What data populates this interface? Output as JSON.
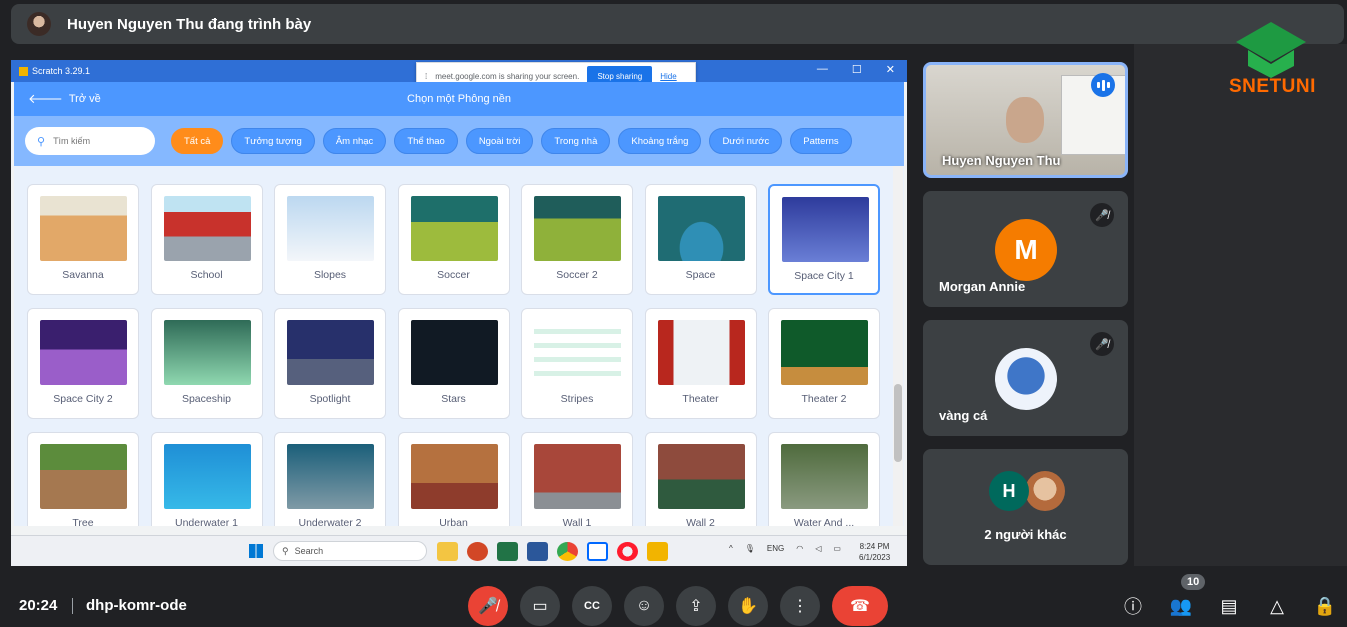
{
  "top_bar": {
    "presenter_text": "Huyen Nguyen Thu đang trình bày"
  },
  "window": {
    "title": "Scratch 3.29.1",
    "controls": [
      "—",
      "☐",
      "✕"
    ],
    "share_banner": {
      "text": "meet.google.com is sharing your screen.",
      "stop": "Stop sharing",
      "hide": "Hide"
    }
  },
  "scratch": {
    "back_label": "Trở về",
    "header_title": "Chọn một Phông nền",
    "search_placeholder": "Tìm kiếm",
    "categories": [
      "Tất cả",
      "Tưởng tượng",
      "Âm nhạc",
      "Thể thao",
      "Ngoài trời",
      "Trong nhà",
      "Khoảng trắng",
      "Dưới nước",
      "Patterns"
    ],
    "active_category": "Tất cả",
    "backdrops": [
      "Savanna",
      "School",
      "Slopes",
      "Soccer",
      "Soccer 2",
      "Space",
      "Space City 1",
      "Space City 2",
      "Spaceship",
      "Spotlight",
      "Stars",
      "Stripes",
      "Theater",
      "Theater 2",
      "Tree",
      "Underwater 1",
      "Underwater 2",
      "Urban",
      "Wall 1",
      "Wall 2",
      "Water And ..."
    ],
    "selected_backdrop": "Space City 1"
  },
  "taskbar": {
    "search": "Search",
    "lang": "ENG",
    "time": "8:24 PM",
    "date": "6/1/2023"
  },
  "logo": {
    "text": "SNETUNI"
  },
  "participants": [
    {
      "name": "Huyen Nguyen Thu",
      "speaking": true
    },
    {
      "name": "Morgan Annie",
      "initial": "M",
      "muted": true
    },
    {
      "name": "vàng cá",
      "muted": true
    },
    {
      "name": "2 người khác",
      "initial": "H"
    }
  ],
  "bottom_bar": {
    "clock": "20:24",
    "meeting_code": "dhp-komr-ode",
    "participant_count": "10"
  },
  "colors": {
    "accent": "#4c97ff",
    "active_chip": "#ff8c1a",
    "end_call": "#ea4335",
    "meet_bg": "#202124"
  }
}
